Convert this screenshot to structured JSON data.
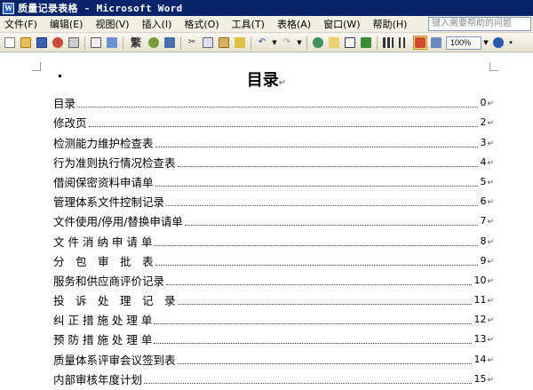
{
  "window": {
    "title": "质量记录表格 - Microsoft Word",
    "app_icon": "word-icon",
    "app_icon_glyph": "W"
  },
  "menu": {
    "items": [
      "文件(F)",
      "编辑(E)",
      "视图(V)",
      "插入(I)",
      "格式(O)",
      "工具(T)",
      "表格(A)",
      "窗口(W)",
      "帮助(H)"
    ],
    "help_placeholder": "键入需要帮助的问题"
  },
  "toolbar": {
    "zoom": "100%",
    "traditional_label": "繁"
  },
  "document": {
    "title": "目录",
    "paragraph_mark": "↵",
    "toc": [
      {
        "label": "目录",
        "page": "0"
      },
      {
        "label": "修改页",
        "page": "2"
      },
      {
        "label": "检测能力维护检查表",
        "page": "3"
      },
      {
        "label": "行为准则执行情况检查表",
        "page": "4"
      },
      {
        "label": "借阅保密资料申请单",
        "page": "5"
      },
      {
        "label": "管理体系文件控制记录",
        "page": "6"
      },
      {
        "label": "文件使用/停用/替换申请单",
        "page": "7"
      },
      {
        "label": "文 件 消 纳 申 请 单",
        "page": "8"
      },
      {
        "label": "分　包　审　批　表",
        "page": "9"
      },
      {
        "label": "服务和供应商评价记录",
        "page": "10"
      },
      {
        "label": "投　诉　处　理　记　录",
        "page": "11"
      },
      {
        "label": "纠 正 措 施 处 理 单",
        "page": "12"
      },
      {
        "label": "预 防 措 施 处 理 单",
        "page": "13"
      },
      {
        "label": "质量体系评审会议签到表",
        "page": "14"
      },
      {
        "label": "内部审核年度计划",
        "page": "15"
      }
    ]
  }
}
